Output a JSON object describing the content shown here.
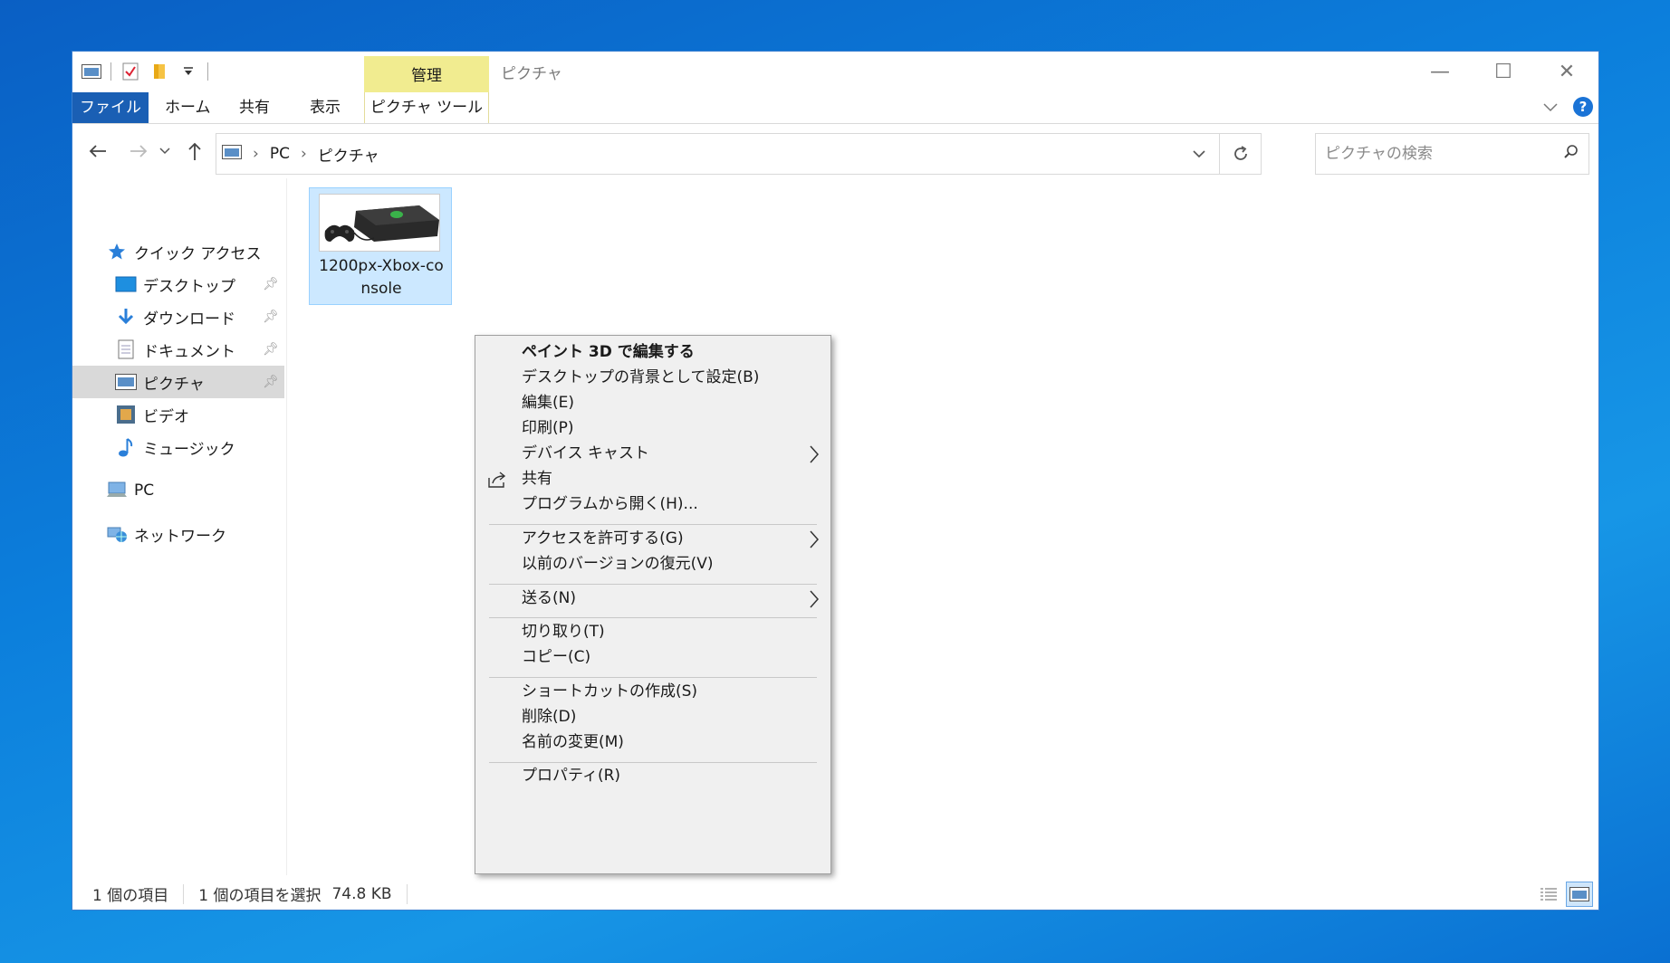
{
  "window": {
    "title": "ピクチャ",
    "context_tab": "管理",
    "controls": {
      "minimize": "—",
      "maximize": "☐",
      "close": "✕"
    }
  },
  "ribbon": {
    "tabs": [
      {
        "label": "ファイル"
      },
      {
        "label": "ホーム"
      },
      {
        "label": "共有"
      },
      {
        "label": "表示"
      },
      {
        "label": "ピクチャ ツール"
      }
    ],
    "help": "?"
  },
  "navigation": {
    "breadcrumb": [
      "PC",
      "ピクチャ"
    ],
    "search_placeholder": "ピクチャの検索"
  },
  "sidebar": {
    "items": [
      {
        "label": "クイック アクセス",
        "icon": "star-icon"
      },
      {
        "label": "デスクトップ",
        "icon": "desktop-icon",
        "pinned": true
      },
      {
        "label": "ダウンロード",
        "icon": "download-icon",
        "pinned": true
      },
      {
        "label": "ドキュメント",
        "icon": "document-icon",
        "pinned": true
      },
      {
        "label": "ピクチャ",
        "icon": "pictures-icon",
        "pinned": true,
        "selected": true
      },
      {
        "label": "ビデオ",
        "icon": "video-icon"
      },
      {
        "label": "ミュージック",
        "icon": "music-icon"
      },
      {
        "label": "PC",
        "icon": "pc-icon"
      },
      {
        "label": "ネットワーク",
        "icon": "network-icon"
      }
    ]
  },
  "files": [
    {
      "name": "1200px-Xbox-console",
      "selected": true
    }
  ],
  "context_menu": {
    "items": [
      {
        "label": "ペイント 3D で編集する",
        "bold": true
      },
      {
        "label": "デスクトップの背景として設定(B)"
      },
      {
        "label": "編集(E)"
      },
      {
        "label": "印刷(P)"
      },
      {
        "label": "デバイス キャスト",
        "submenu": true
      },
      {
        "label": "共有",
        "icon": "share-icon"
      },
      {
        "label": "プログラムから開く(H)..."
      },
      {
        "label": "アクセスを許可する(G)",
        "submenu": true
      },
      {
        "label": "以前のバージョンの復元(V)"
      },
      {
        "label": "送る(N)",
        "submenu": true
      },
      {
        "label": "切り取り(T)"
      },
      {
        "label": "コピー(C)"
      },
      {
        "label": "ショートカットの作成(S)"
      },
      {
        "label": "削除(D)"
      },
      {
        "label": "名前の変更(M)"
      },
      {
        "label": "プロパティ(R)"
      }
    ]
  },
  "status": {
    "item_count": "1 個の項目",
    "selection": "1 個の項目を選択",
    "size": "74.8 KB"
  },
  "colors": {
    "file_tab": "#1a5fb4",
    "manage_tab": "#f1ec90",
    "selection": "#cce8ff",
    "desktop": "#0c7fdc"
  }
}
